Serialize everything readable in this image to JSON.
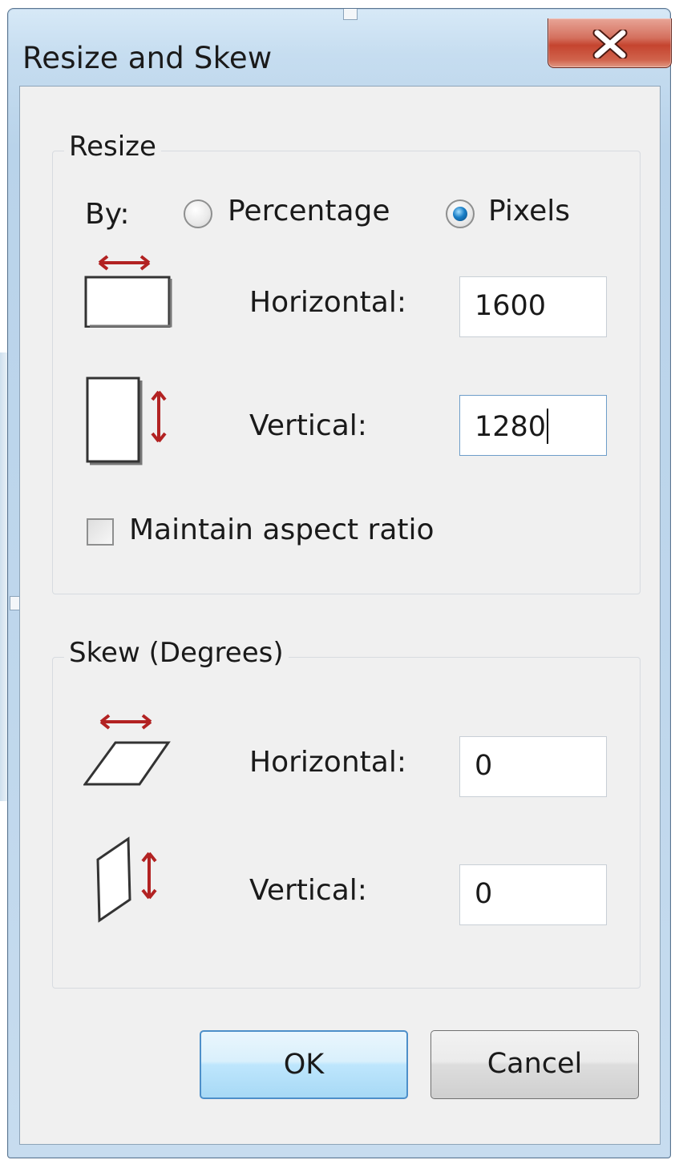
{
  "window": {
    "title": "Resize and Skew",
    "close_label": "X"
  },
  "resize": {
    "group_title": "Resize",
    "by_label": "By:",
    "options": [
      {
        "label": "Percentage",
        "selected": false
      },
      {
        "label": "Pixels",
        "selected": true
      }
    ],
    "horizontal_label": "Horizontal:",
    "horizontal_value": "1600",
    "vertical_label": "Vertical:",
    "vertical_value": "1280",
    "maintain_aspect_label": "Maintain aspect ratio",
    "maintain_aspect_checked": false
  },
  "skew": {
    "group_title": "Skew (Degrees)",
    "horizontal_label": "Horizontal:",
    "horizontal_value": "0",
    "vertical_label": "Vertical:",
    "vertical_value": "0"
  },
  "buttons": {
    "ok_label": "OK",
    "cancel_label": "Cancel"
  },
  "colors": {
    "arrow": "#b22222",
    "title_bar": "#c6ddf0",
    "close": "#c5442f",
    "selected_radio": "#1a7fc7"
  },
  "icons": {
    "close": "close-icon",
    "resize_horizontal": "resize-horizontal-icon",
    "resize_vertical": "resize-vertical-icon",
    "skew_horizontal": "skew-horizontal-icon",
    "skew_vertical": "skew-vertical-icon"
  }
}
